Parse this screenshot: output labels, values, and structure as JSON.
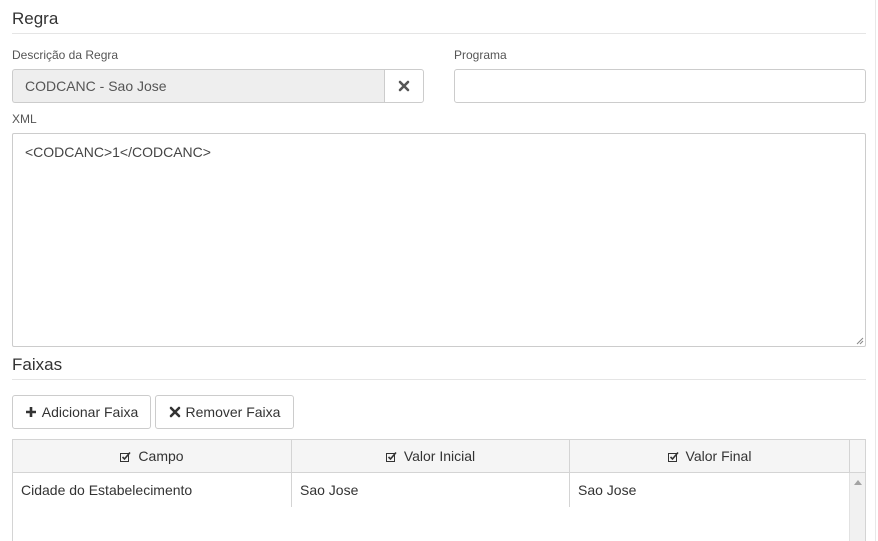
{
  "regra": {
    "title": "Regra",
    "descricao_label": "Descrição da Regra",
    "descricao_value": "CODCANC - Sao Jose",
    "programa_label": "Programa",
    "programa_value": "",
    "xml_label": "XML",
    "xml_value": "<CODCANC>1</CODCANC>"
  },
  "faixas": {
    "title": "Faixas",
    "add_label": "Adicionar Faixa",
    "remove_label": "Remover Faixa",
    "columns": [
      "Campo",
      "Valor Inicial",
      "Valor Final"
    ],
    "rows": [
      [
        "Cidade do Estabelecimento",
        "Sao Jose",
        "Sao Jose"
      ]
    ]
  }
}
